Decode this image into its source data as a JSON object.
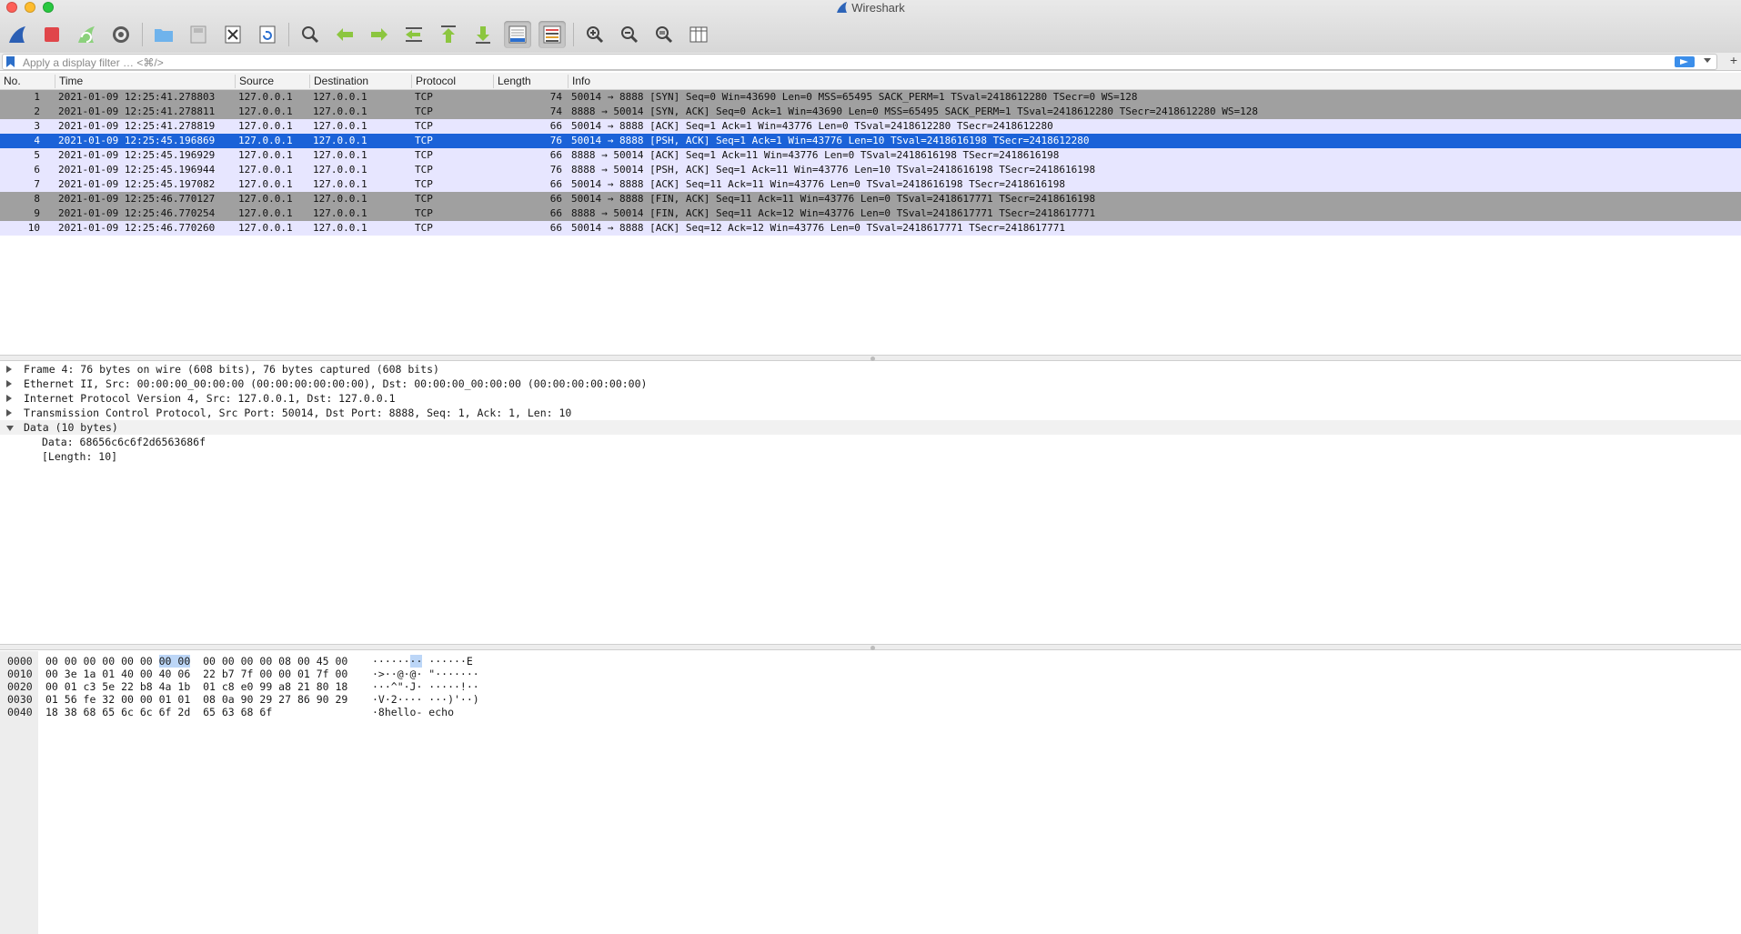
{
  "window": {
    "title": "Wireshark"
  },
  "toolbar": {
    "buttons": [
      {
        "name": "start-capture-icon"
      },
      {
        "name": "stop-capture-icon"
      },
      {
        "name": "restart-capture-icon"
      },
      {
        "name": "capture-options-icon"
      },
      {
        "name": "open-file-icon"
      },
      {
        "name": "save-file-icon"
      },
      {
        "name": "close-file-icon"
      },
      {
        "name": "reload-file-icon"
      },
      {
        "name": "find-packet-icon"
      },
      {
        "name": "go-back-icon"
      },
      {
        "name": "go-forward-icon"
      },
      {
        "name": "go-to-packet-icon"
      },
      {
        "name": "first-packet-icon"
      },
      {
        "name": "last-packet-icon"
      },
      {
        "name": "autoscroll-icon"
      },
      {
        "name": "colorize-icon"
      },
      {
        "name": "zoom-in-icon"
      },
      {
        "name": "zoom-out-icon"
      },
      {
        "name": "normal-size-icon"
      },
      {
        "name": "resize-columns-icon"
      }
    ]
  },
  "filter": {
    "placeholder": "Apply a display filter … <⌘/>"
  },
  "columns": {
    "no": "No.",
    "time": "Time",
    "source": "Source",
    "destination": "Destination",
    "protocol": "Protocol",
    "length": "Length",
    "info": "Info"
  },
  "packets": [
    {
      "no": "1",
      "time": "2021-01-09 12:25:41.278803",
      "src": "127.0.0.1",
      "dst": "127.0.0.1",
      "proto": "TCP",
      "len": "74",
      "info": "50014 → 8888 [SYN] Seq=0 Win=43690 Len=0 MSS=65495 SACK_PERM=1 TSval=2418612280 TSecr=0 WS=128",
      "style": "gray"
    },
    {
      "no": "2",
      "time": "2021-01-09 12:25:41.278811",
      "src": "127.0.0.1",
      "dst": "127.0.0.1",
      "proto": "TCP",
      "len": "74",
      "info": "8888 → 50014 [SYN, ACK] Seq=0 Ack=1 Win=43690 Len=0 MSS=65495 SACK_PERM=1 TSval=2418612280 TSecr=2418612280 WS=128",
      "style": "gray"
    },
    {
      "no": "3",
      "time": "2021-01-09 12:25:41.278819",
      "src": "127.0.0.1",
      "dst": "127.0.0.1",
      "proto": "TCP",
      "len": "66",
      "info": "50014 → 8888 [ACK] Seq=1 Ack=1 Win=43776 Len=0 TSval=2418612280 TSecr=2418612280",
      "style": "lav"
    },
    {
      "no": "4",
      "time": "2021-01-09 12:25:45.196869",
      "src": "127.0.0.1",
      "dst": "127.0.0.1",
      "proto": "TCP",
      "len": "76",
      "info": "50014 → 8888 [PSH, ACK] Seq=1 Ack=1 Win=43776 Len=10 TSval=2418616198 TSecr=2418612280",
      "style": "sel"
    },
    {
      "no": "5",
      "time": "2021-01-09 12:25:45.196929",
      "src": "127.0.0.1",
      "dst": "127.0.0.1",
      "proto": "TCP",
      "len": "66",
      "info": "8888 → 50014 [ACK] Seq=1 Ack=11 Win=43776 Len=0 TSval=2418616198 TSecr=2418616198",
      "style": "lav"
    },
    {
      "no": "6",
      "time": "2021-01-09 12:25:45.196944",
      "src": "127.0.0.1",
      "dst": "127.0.0.1",
      "proto": "TCP",
      "len": "76",
      "info": "8888 → 50014 [PSH, ACK] Seq=1 Ack=11 Win=43776 Len=10 TSval=2418616198 TSecr=2418616198",
      "style": "lav"
    },
    {
      "no": "7",
      "time": "2021-01-09 12:25:45.197082",
      "src": "127.0.0.1",
      "dst": "127.0.0.1",
      "proto": "TCP",
      "len": "66",
      "info": "50014 → 8888 [ACK] Seq=11 Ack=11 Win=43776 Len=0 TSval=2418616198 TSecr=2418616198",
      "style": "lav"
    },
    {
      "no": "8",
      "time": "2021-01-09 12:25:46.770127",
      "src": "127.0.0.1",
      "dst": "127.0.0.1",
      "proto": "TCP",
      "len": "66",
      "info": "50014 → 8888 [FIN, ACK] Seq=11 Ack=11 Win=43776 Len=0 TSval=2418617771 TSecr=2418616198",
      "style": "gray"
    },
    {
      "no": "9",
      "time": "2021-01-09 12:25:46.770254",
      "src": "127.0.0.1",
      "dst": "127.0.0.1",
      "proto": "TCP",
      "len": "66",
      "info": "8888 → 50014 [FIN, ACK] Seq=11 Ack=12 Win=43776 Len=0 TSval=2418617771 TSecr=2418617771",
      "style": "gray"
    },
    {
      "no": "10",
      "time": "2021-01-09 12:25:46.770260",
      "src": "127.0.0.1",
      "dst": "127.0.0.1",
      "proto": "TCP",
      "len": "66",
      "info": "50014 → 8888 [ACK] Seq=12 Ack=12 Win=43776 Len=0 TSval=2418617771 TSecr=2418617771",
      "style": "lav"
    }
  ],
  "details": [
    {
      "text": "Frame 4: 76 bytes on wire (608 bits), 76 bytes captured (608 bits)",
      "state": "closed",
      "child": false,
      "shaded": false
    },
    {
      "text": "Ethernet II, Src: 00:00:00_00:00:00 (00:00:00:00:00:00), Dst: 00:00:00_00:00:00 (00:00:00:00:00:00)",
      "state": "closed",
      "child": false,
      "shaded": false
    },
    {
      "text": "Internet Protocol Version 4, Src: 127.0.0.1, Dst: 127.0.0.1",
      "state": "closed",
      "child": false,
      "shaded": false
    },
    {
      "text": "Transmission Control Protocol, Src Port: 50014, Dst Port: 8888, Seq: 1, Ack: 1, Len: 10",
      "state": "closed",
      "child": false,
      "shaded": false
    },
    {
      "text": "Data (10 bytes)",
      "state": "open",
      "child": false,
      "shaded": true
    },
    {
      "text": "Data: 68656c6c6f2d6563686f",
      "state": "none",
      "child": true,
      "shaded": false
    },
    {
      "text": "[Length: 10]",
      "state": "none",
      "child": true,
      "shaded": false
    }
  ],
  "hex": [
    {
      "offset": "0000",
      "pre": "00 00 00 00 00 00 ",
      "hl": "00 00",
      "mid": "  00 00 00 00 08 00 45 00",
      "apre": "······",
      "ahl": "··",
      "apost": " ······E"
    },
    {
      "offset": "0010",
      "pre": "00 3e 1a 01 40 00 40 06  22 b7 7f 00 00 01 7f 00",
      "hl": "",
      "mid": "",
      "apre": "·>··@·@· \"·······",
      "ahl": "",
      "apost": ""
    },
    {
      "offset": "0020",
      "pre": "00 01 c3 5e 22 b8 4a 1b  01 c8 e0 99 a8 21 80 18",
      "hl": "",
      "mid": "",
      "apre": "···^\"·J· ·····!··",
      "ahl": "",
      "apost": ""
    },
    {
      "offset": "0030",
      "pre": "01 56 fe 32 00 00 01 01  08 0a 90 29 27 86 90 29",
      "hl": "",
      "mid": "",
      "apre": "·V·2···· ···)'··)",
      "ahl": "",
      "apost": ""
    },
    {
      "offset": "0040",
      "pre": "18 38 68 65 6c 6c 6f 2d  65 63 68 6f",
      "hl": "",
      "mid": "",
      "apre": "·8hello- echo",
      "ahl": "",
      "apost": ""
    }
  ]
}
